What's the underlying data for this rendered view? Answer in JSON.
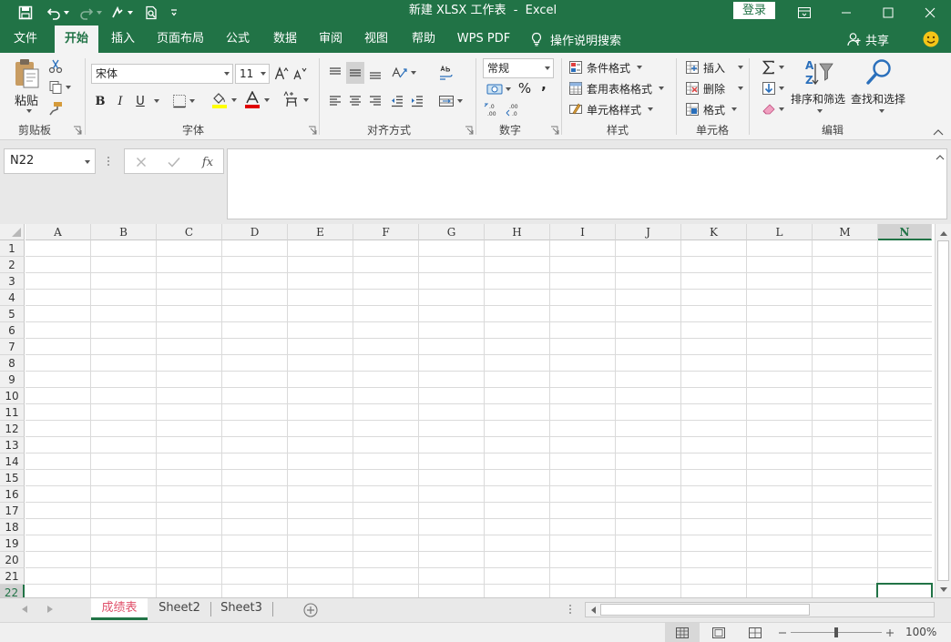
{
  "titlebar": {
    "title": "新建 XLSX 工作表  -  Excel",
    "login": "登录"
  },
  "ribbon_tabs": [
    "文件",
    "开始",
    "插入",
    "页面布局",
    "公式",
    "数据",
    "审阅",
    "视图",
    "帮助",
    "WPS PDF"
  ],
  "tell_me": "操作说明搜索",
  "share": "共享",
  "clipboard": {
    "paste": "粘贴",
    "label": "剪贴板"
  },
  "font": {
    "name": "宋体",
    "size": "11",
    "bold": "B",
    "italic": "I",
    "underline": "U",
    "label": "字体"
  },
  "alignment": {
    "label": "对齐方式"
  },
  "number": {
    "format": "常规",
    "percent": "%",
    "comma": ",",
    "label": "数字"
  },
  "styles": {
    "conditional": "条件格式",
    "table": "套用表格格式",
    "cell": "单元格样式",
    "label": "样式"
  },
  "cells": {
    "insert": "插入",
    "delete": "删除",
    "format": "格式",
    "label": "单元格"
  },
  "editing": {
    "sortfilter": "排序和筛选",
    "findselect": "查找和选择",
    "label": "编辑"
  },
  "formula": {
    "namebox": "N22",
    "fx": "fx",
    "value": ""
  },
  "columns": [
    "A",
    "B",
    "C",
    "D",
    "E",
    "F",
    "G",
    "H",
    "I",
    "J",
    "K",
    "L",
    "M",
    "N"
  ],
  "rows": [
    "1",
    "2",
    "3",
    "4",
    "5",
    "6",
    "7",
    "8",
    "9",
    "10",
    "11",
    "12",
    "13",
    "14",
    "15",
    "16",
    "17",
    "18",
    "19",
    "20",
    "21",
    "22"
  ],
  "sheets": [
    "成绩表",
    "Sheet2",
    "Sheet3"
  ],
  "zoom": "100%",
  "colors": {
    "accent": "#217346",
    "ribbon": "#f3f3f3"
  }
}
